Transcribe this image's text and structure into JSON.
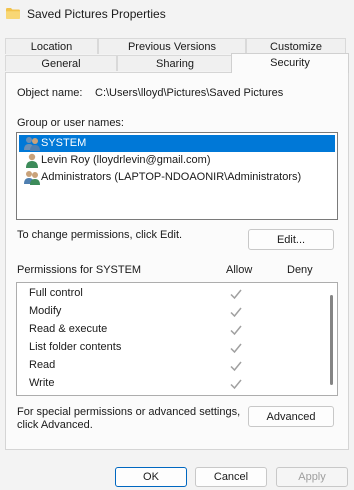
{
  "window": {
    "title": "Saved Pictures Properties"
  },
  "tabs": {
    "row1": [
      {
        "label": "Location"
      },
      {
        "label": "Previous Versions"
      },
      {
        "label": "Customize"
      }
    ],
    "row2": [
      {
        "label": "General"
      },
      {
        "label": "Sharing"
      },
      {
        "label": "Security",
        "active": true
      }
    ]
  },
  "security": {
    "object_name_label": "Object name:",
    "object_name_value": "C:\\Users\\lloyd\\Pictures\\Saved Pictures",
    "group_label": "Group or user names:",
    "users": [
      {
        "name": "SYSTEM",
        "selected": true,
        "icon": "user-group-icon"
      },
      {
        "name": "Levin Roy (lloydrlevin@gmail.com)",
        "selected": false,
        "icon": "user-icon"
      },
      {
        "name": "Administrators (LAPTOP-NDOAONIR\\Administrators)",
        "selected": false,
        "icon": "user-group-icon"
      }
    ],
    "change_perm_text": "To change permissions, click Edit.",
    "edit_button": "Edit...",
    "permissions_for_label": "Permissions for SYSTEM",
    "allow_header": "Allow",
    "deny_header": "Deny",
    "permissions": [
      {
        "name": "Full control",
        "allow": true,
        "deny": false
      },
      {
        "name": "Modify",
        "allow": true,
        "deny": false
      },
      {
        "name": "Read & execute",
        "allow": true,
        "deny": false
      },
      {
        "name": "List folder contents",
        "allow": true,
        "deny": false
      },
      {
        "name": "Read",
        "allow": true,
        "deny": false
      },
      {
        "name": "Write",
        "allow": true,
        "deny": false
      }
    ],
    "special_text_line1": "For special permissions or advanced settings,",
    "special_text_line2": "click Advanced.",
    "advanced_button": "Advanced"
  },
  "footer": {
    "ok": "OK",
    "cancel": "Cancel",
    "apply": "Apply"
  },
  "colors": {
    "selection": "#0078d7",
    "primary_border": "#0067c0",
    "check": "#a0a0a0"
  }
}
